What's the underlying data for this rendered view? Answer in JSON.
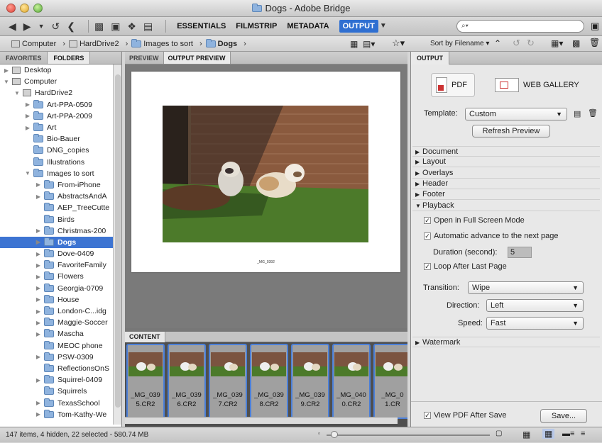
{
  "window": {
    "title": "Dogs - Adobe Bridge"
  },
  "toolbar": {
    "workspaces": [
      "ESSENTIALS",
      "FILMSTRIP",
      "METADATA",
      "OUTPUT"
    ],
    "active_workspace": "OUTPUT",
    "search_placeholder": "⌕▾"
  },
  "path": {
    "items": [
      "Computer",
      "HardDrive2",
      "Images to sort",
      "Dogs"
    ],
    "sort_label": "Sort by Filename"
  },
  "left_panel": {
    "tabs": [
      "FAVORITES",
      "FOLDERS"
    ],
    "active_tab": "FOLDERS",
    "tree": [
      {
        "label": "Desktop",
        "level": 0,
        "expanded": false
      },
      {
        "label": "Computer",
        "level": 0,
        "expanded": true
      },
      {
        "label": "HardDrive2",
        "level": 1,
        "expanded": true
      },
      {
        "label": "Art-PPA-0509",
        "level": 2,
        "expanded": false
      },
      {
        "label": "Art-PPA-2009",
        "level": 2,
        "expanded": false
      },
      {
        "label": "Art",
        "level": 2,
        "expanded": false
      },
      {
        "label": "Bio-Bauer",
        "level": 2,
        "expanded": null
      },
      {
        "label": "DNG_copies",
        "level": 2,
        "expanded": null
      },
      {
        "label": "Illustrations",
        "level": 2,
        "expanded": null
      },
      {
        "label": "Images to sort",
        "level": 2,
        "expanded": true
      },
      {
        "label": "From-iPhone",
        "level": 3,
        "expanded": false
      },
      {
        "label": "AbstractsAndA",
        "level": 3,
        "expanded": false
      },
      {
        "label": "AEP_TreeCutte",
        "level": 3,
        "expanded": null
      },
      {
        "label": "Birds",
        "level": 3,
        "expanded": null
      },
      {
        "label": "Christmas-200",
        "level": 3,
        "expanded": false
      },
      {
        "label": "Dogs",
        "level": 3,
        "expanded": false,
        "selected": true
      },
      {
        "label": "Dove-0409",
        "level": 3,
        "expanded": false
      },
      {
        "label": "FavoriteFamily",
        "level": 3,
        "expanded": false
      },
      {
        "label": "Flowers",
        "level": 3,
        "expanded": false
      },
      {
        "label": "Georgia-0709",
        "level": 3,
        "expanded": false
      },
      {
        "label": "House",
        "level": 3,
        "expanded": false
      },
      {
        "label": "London-C...idg",
        "level": 3,
        "expanded": false
      },
      {
        "label": "Maggie-Soccer",
        "level": 3,
        "expanded": false
      },
      {
        "label": "Mascha",
        "level": 3,
        "expanded": false
      },
      {
        "label": "MEOC phone",
        "level": 3,
        "expanded": null
      },
      {
        "label": "PSW-0309",
        "level": 3,
        "expanded": false
      },
      {
        "label": "ReflectionsOnS",
        "level": 3,
        "expanded": null
      },
      {
        "label": "Squirrel-0409",
        "level": 3,
        "expanded": false
      },
      {
        "label": "Squirrels",
        "level": 3,
        "expanded": null
      },
      {
        "label": "TexasSchool",
        "level": 3,
        "expanded": false
      },
      {
        "label": "Tom-Kathy-We",
        "level": 3,
        "expanded": false
      }
    ]
  },
  "center": {
    "tabs": [
      "PREVIEW",
      "OUTPUT PREVIEW"
    ],
    "active_tab": "OUTPUT PREVIEW",
    "caption": "_MG_0392",
    "content_tab": "CONTENT",
    "thumbnails": [
      {
        "line1": "_MG_039",
        "line2": "5.CR2"
      },
      {
        "line1": "_MG_039",
        "line2": "6.CR2"
      },
      {
        "line1": "_MG_039",
        "line2": "7.CR2"
      },
      {
        "line1": "_MG_039",
        "line2": "8.CR2"
      },
      {
        "line1": "_MG_039",
        "line2": "9.CR2"
      },
      {
        "line1": "_MG_040",
        "line2": "0.CR2"
      },
      {
        "line1": "_MG_0",
        "line2": "1.CR"
      }
    ]
  },
  "output": {
    "tab": "OUTPUT",
    "pdf_label": "PDF",
    "web_label": "WEB GALLERY",
    "template_label": "Template:",
    "template_value": "Custom",
    "refresh_label": "Refresh Preview",
    "sections": [
      "Document",
      "Layout",
      "Overlays",
      "Header",
      "Footer",
      "Playback"
    ],
    "playback": {
      "full_screen": "Open in Full Screen Mode",
      "auto_advance": "Automatic advance to the next page",
      "duration_label": "Duration (second):",
      "duration_value": "5",
      "loop": "Loop After Last Page",
      "transition_label": "Transition:",
      "transition_value": "Wipe",
      "direction_label": "Direction:",
      "direction_value": "Left",
      "speed_label": "Speed:",
      "speed_value": "Fast"
    },
    "watermark": "Watermark",
    "view_pdf": "View PDF After Save",
    "save_label": "Save..."
  },
  "status": {
    "text": "147 items, 4 hidden, 22 selected - 580.74 MB"
  }
}
